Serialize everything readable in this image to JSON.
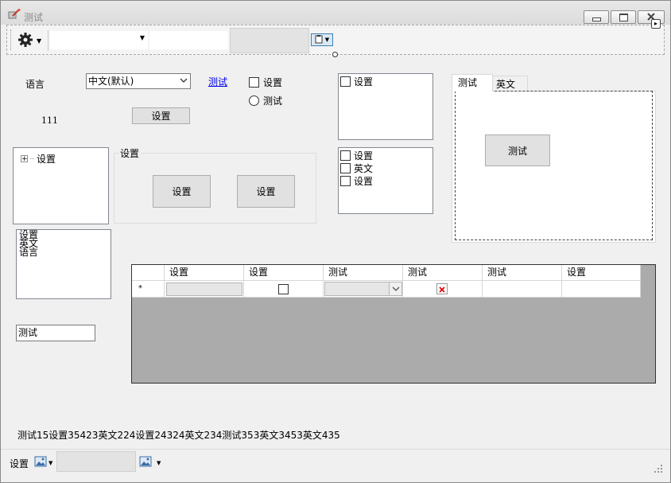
{
  "window": {
    "title": "测试",
    "controls": [
      "minimize-icon",
      "maximize-icon",
      "close-icon"
    ]
  },
  "toolbar": {
    "gear_icon": "gear-icon",
    "combo_value": "",
    "text_value": "",
    "overflow_icon": "chevron-right-icon"
  },
  "form": {
    "language_label": "语言",
    "language_value": "中文(默认)",
    "link_text": "测试",
    "checkbox_label": "设置",
    "radio_label": "测试",
    "number_label": "111",
    "settings_button": "设置"
  },
  "tree": {
    "items": [
      {
        "label": "设置",
        "expander": "+"
      }
    ]
  },
  "groupbox": {
    "title": "设置",
    "buttons": [
      "设置",
      "设置"
    ]
  },
  "checked_list_1": {
    "items": [
      "设置"
    ]
  },
  "checked_list_2": {
    "items": [
      "设置",
      "英文",
      "设置"
    ]
  },
  "tabs": {
    "items": [
      "测试",
      "英文"
    ],
    "active": 0,
    "button": "测试"
  },
  "listbox": {
    "items": [
      "设置",
      "英文",
      "语言"
    ]
  },
  "textbox": {
    "value": "测试"
  },
  "grid": {
    "columns": [
      "设置",
      "设置",
      "测试",
      "测试",
      "测试",
      "设置"
    ],
    "new_row_marker": "*"
  },
  "footer_text": "测试15设置35423英文224设置24324英文234测试353英文3453英文435",
  "statusbar": {
    "label": "设置",
    "image_icon": "image-icon",
    "text_value": ""
  }
}
